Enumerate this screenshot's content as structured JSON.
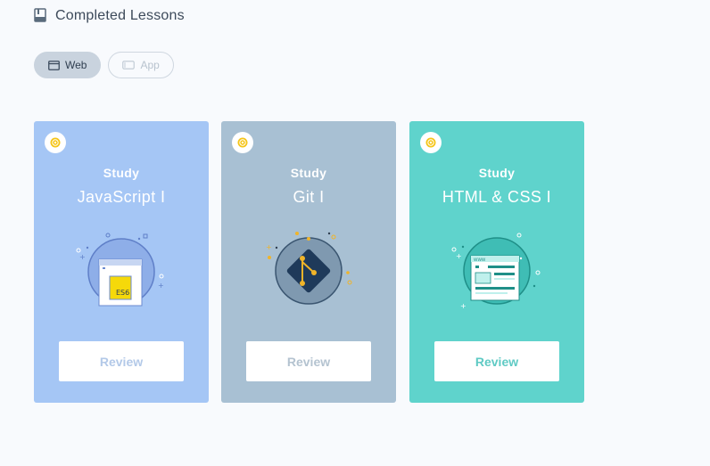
{
  "header": {
    "title": "Completed Lessons",
    "icon": "book-icon"
  },
  "filters": [
    {
      "label": "Web",
      "icon": "browser-icon",
      "active": true
    },
    {
      "label": "App",
      "icon": "device-icon",
      "active": false
    }
  ],
  "cards": [
    {
      "kicker": "Study",
      "name": "JavaScript I",
      "button": "Review",
      "illustration": "es6-browser-icon",
      "badge_icon": "medal-icon",
      "color": "#a5c6f5",
      "button_text_color": "#b3c9e8"
    },
    {
      "kicker": "Study",
      "name": "Git I",
      "button": "Review",
      "illustration": "git-logo-icon",
      "badge_icon": "medal-icon",
      "color": "#a8c0d3",
      "button_text_color": "#b4c3d0"
    },
    {
      "kicker": "Study",
      "name": "HTML & CSS I",
      "button": "Review",
      "illustration": "webpage-layout-icon",
      "badge_icon": "medal-icon",
      "color": "#5fd3cc",
      "button_text_color": "#5fcac4"
    }
  ],
  "es6_label": "ES6",
  "mini_browser_label": "WWW"
}
